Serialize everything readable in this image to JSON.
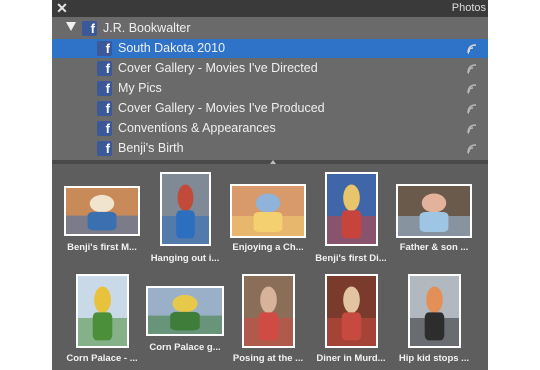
{
  "window": {
    "close_glyph": "✕",
    "title": "Photos"
  },
  "tree": {
    "root": {
      "label": "J.R. Bookwalter",
      "icon": "facebook-icon",
      "expanded": true
    },
    "albums": [
      {
        "label": "South Dakota 2010",
        "selected": true
      },
      {
        "label": "Cover Gallery - Movies I've Directed",
        "selected": false
      },
      {
        "label": "My Pics",
        "selected": false
      },
      {
        "label": "Cover Gallery - Movies I've Produced",
        "selected": false
      },
      {
        "label": "Conventions & Appearances",
        "selected": false
      },
      {
        "label": "Benji's Birth",
        "selected": false
      }
    ]
  },
  "photos": [
    {
      "caption": "Benji's first M...",
      "palette": [
        "#c98a5a",
        "#f1e4cf",
        "#3a6fb0"
      ]
    },
    {
      "caption": "Hanging out i...",
      "palette": [
        "#7f8a96",
        "#c24a3a",
        "#2d6fbf"
      ]
    },
    {
      "caption": "Enjoying a Ch...",
      "palette": [
        "#d89a6b",
        "#8fb3da",
        "#f4d070"
      ]
    },
    {
      "caption": "Benji's first Di...",
      "palette": [
        "#3f66a8",
        "#e8c46a",
        "#c9433d"
      ]
    },
    {
      "caption": "Father & son ...",
      "palette": [
        "#6a5a4c",
        "#e2b39a",
        "#9ec5e4"
      ]
    },
    {
      "caption": "Corn Palace - ...",
      "palette": [
        "#c9d9e8",
        "#e8c23a",
        "#4c8f3a"
      ]
    },
    {
      "caption": "Corn Palace g...",
      "palette": [
        "#9ab0c8",
        "#e6c84a",
        "#3f7d3b"
      ]
    },
    {
      "caption": "Posing at the ...",
      "palette": [
        "#8b6e58",
        "#d6b39a",
        "#d04b43"
      ]
    },
    {
      "caption": "Diner in Murd...",
      "palette": [
        "#7a3b2c",
        "#e2c3a2",
        "#c64a3f"
      ]
    },
    {
      "caption": "Hip kid stops ...",
      "palette": [
        "#b1b8c0",
        "#e29057",
        "#2d2d2d"
      ]
    }
  ]
}
